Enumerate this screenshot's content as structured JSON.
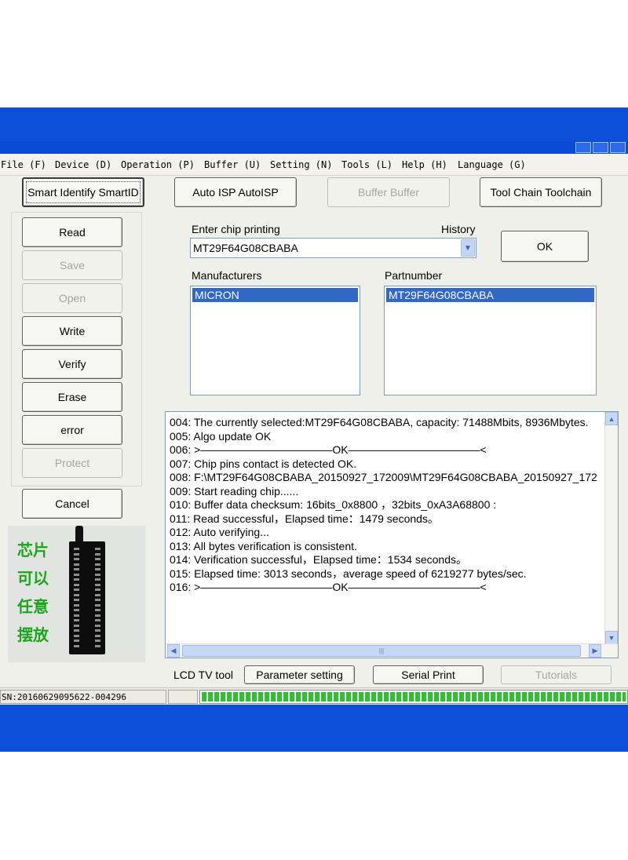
{
  "menu": [
    "File (F)",
    "Device (D)",
    "Operation (P)",
    "Buffer (U)",
    "Setting (N)",
    "Tools (L)",
    "Help (H)",
    "Language (G)"
  ],
  "toolbar": {
    "smart_identify": "Smart Identify SmartID",
    "auto_isp": "Auto ISP AutoISP",
    "buffer": "Buffer Buffer",
    "tool_chain": "Tool Chain Toolchain"
  },
  "side_buttons": {
    "read": "Read",
    "save": "Save",
    "open": "Open",
    "write": "Write",
    "verify": "Verify",
    "erase": "Erase",
    "error": "error",
    "protect": "Protect",
    "cancel": "Cancel"
  },
  "chip_entry": {
    "label": "Enter chip printing",
    "history_label": "History",
    "value": "MT29F64G08CBABA",
    "ok": "OK"
  },
  "manufacturers": {
    "label": "Manufacturers",
    "items": [
      "MICRON"
    ]
  },
  "partnumbers": {
    "label": "Partnumber",
    "items": [
      "MT29F64G08CBABA"
    ]
  },
  "log": [
    "004:  The currently selected:MT29F64G08CBABA, capacity: 71488Mbits, 8936Mbytes.",
    "005:  Algo update OK",
    "006:  >————————————OK————————————<",
    "007:  Chip pins contact is detected OK.",
    "008:  F:\\MT29F64G08CBABA_20150927_172009\\MT29F64G08CBABA_20150927_172",
    "009:  Start reading chip......",
    "010:  Buffer data checksum: 16bits_0x8800 ，32bits_0xA3A68800 :",
    "011:  Read successful，Elapsed time：1479 seconds。",
    "012:  Auto verifying...",
    "013:  All bytes verification is consistent.",
    "014:  Verification successful，Elapsed time：1534 seconds。",
    "015:  Elapsed time: 3013 seconds，average speed of 6219277 bytes/sec.",
    "016:  >————————————OK————————————<"
  ],
  "chip_photo_text": [
    "芯片",
    "可以",
    "任意",
    "摆放"
  ],
  "bottom": {
    "lcd_label": "LCD TV tool",
    "parameter_setting": "Parameter setting",
    "serial_print": "Serial Print",
    "tutorials": "Tutorials"
  },
  "status": {
    "sn": "SN:20160629095622-004296",
    "progress": 1.0
  },
  "colors": {
    "accent_blue": "#0d4fd6",
    "selection": "#3168c6",
    "progress_green": "#2fbf2f"
  }
}
